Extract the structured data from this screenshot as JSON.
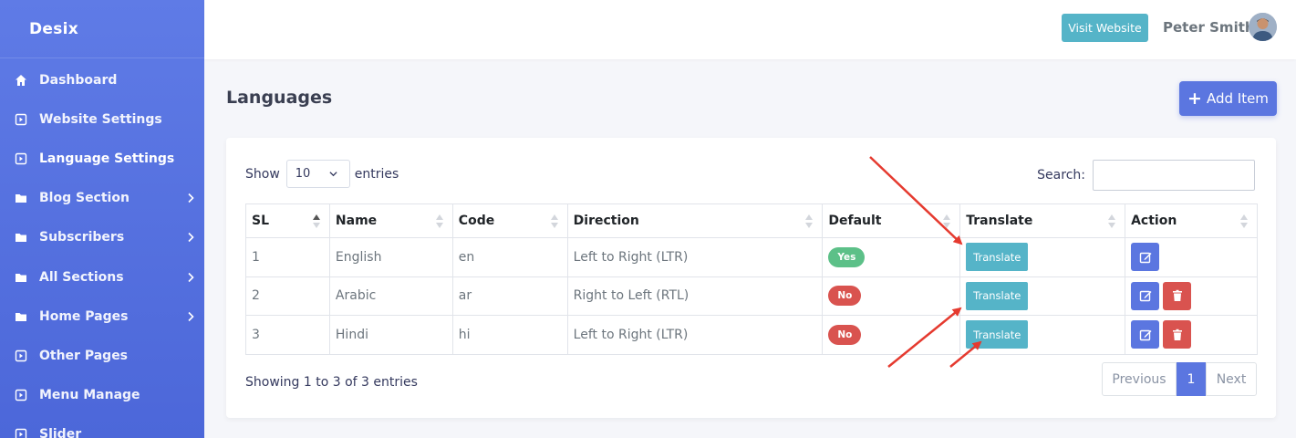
{
  "sidebar": {
    "brand": "Desix",
    "items": [
      {
        "label": "Dashboard",
        "icon": "home-icon",
        "has_submenu": false
      },
      {
        "label": "Website Settings",
        "icon": "square-caret-icon",
        "has_submenu": false
      },
      {
        "label": "Language Settings",
        "icon": "square-caret-icon",
        "has_submenu": false,
        "active": true
      },
      {
        "label": "Blog Section",
        "icon": "folder-icon",
        "has_submenu": true
      },
      {
        "label": "Subscribers",
        "icon": "folder-icon",
        "has_submenu": true
      },
      {
        "label": "All Sections",
        "icon": "folder-icon",
        "has_submenu": true
      },
      {
        "label": "Home Pages",
        "icon": "folder-icon",
        "has_submenu": true
      },
      {
        "label": "Other Pages",
        "icon": "square-caret-icon",
        "has_submenu": false
      },
      {
        "label": "Menu Manage",
        "icon": "square-caret-icon",
        "has_submenu": false
      },
      {
        "label": "Slider",
        "icon": "square-caret-icon",
        "has_submenu": false
      }
    ]
  },
  "header": {
    "visit_label": "Visit Website",
    "user_name": "Peter Smith"
  },
  "page": {
    "title": "Languages",
    "add_label": "Add Item"
  },
  "table_controls": {
    "show_label": "Show",
    "page_length": "10",
    "entries_label": "entries",
    "search_label": "Search:",
    "search_value": ""
  },
  "table": {
    "columns": [
      "SL",
      "Name",
      "Code",
      "Direction",
      "Default",
      "Translate",
      "Action"
    ],
    "rows": [
      {
        "sl": "1",
        "name": "English",
        "code": "en",
        "direction": "Left to Right (LTR)",
        "default": "Yes",
        "translate": "Translate",
        "deletable": false
      },
      {
        "sl": "2",
        "name": "Arabic",
        "code": "ar",
        "direction": "Right to Left (RTL)",
        "default": "No",
        "translate": "Translate",
        "deletable": true
      },
      {
        "sl": "3",
        "name": "Hindi",
        "code": "hi",
        "direction": "Left to Right (LTR)",
        "default": "No",
        "translate": "Translate",
        "deletable": true
      }
    ]
  },
  "footer": {
    "info": "Showing 1 to 3 of 3 entries",
    "previous": "Previous",
    "current_page": "1",
    "next": "Next"
  },
  "colors": {
    "sidebar": "#5b76e0",
    "primary": "#5b76e0",
    "info": "#55b4c8",
    "success": "#5cc088",
    "danger": "#d9534f",
    "annotation_arrow": "#e53a2f"
  }
}
